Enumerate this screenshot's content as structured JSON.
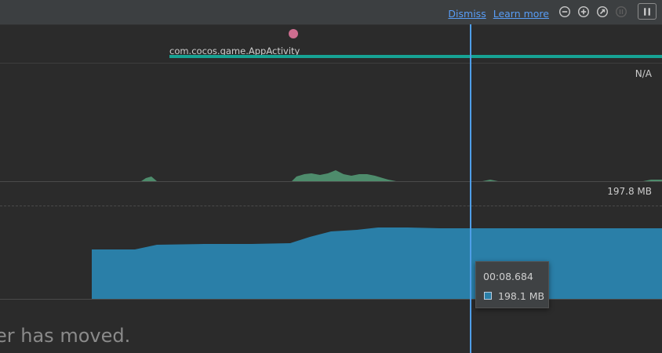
{
  "toolbar": {
    "dismiss_label": "Dismiss",
    "learn_more_label": "Learn more",
    "icons": [
      "zoom-out-icon",
      "zoom-in-icon",
      "reset-zoom-icon",
      "disabled-icon",
      "pause-icon"
    ]
  },
  "event_track": {
    "activity_name": "com.cocos.game.AppActivity",
    "activity_color": "#16a394",
    "event_marker_color": "#cd6d8f"
  },
  "cpu": {
    "value_label": "N/A",
    "color": "#4e8c6c"
  },
  "memory": {
    "max_label": "197.8 MB",
    "color": "#2a7fa8"
  },
  "tooltip": {
    "time": "00:08.684",
    "value": "198.1 MB"
  },
  "cursor_color": "#4f9ee8",
  "footer": {
    "message": "er has moved."
  }
}
